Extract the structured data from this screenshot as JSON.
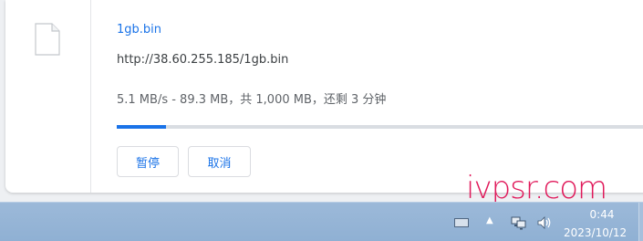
{
  "download": {
    "file_name": "1gb.bin",
    "url": "http://38.60.255.185/1gb.bin",
    "status": "5.1 MB/s - 89.3 MB，共 1,000 MB，还剩 3 分钟",
    "progress_fraction": 0.0893,
    "file_icon": "file-icon",
    "pause_label": "暂停",
    "cancel_label": "取消",
    "accent_color": "#1a73e8"
  },
  "watermark": {
    "text": "ivpsr.com",
    "color": "#e0195a"
  },
  "taskbar": {
    "time": "0:44",
    "date": "2023/10/12",
    "tray_icons": [
      "keyboard-icon",
      "chevron-up-icon",
      "network-icon",
      "volume-icon"
    ]
  }
}
